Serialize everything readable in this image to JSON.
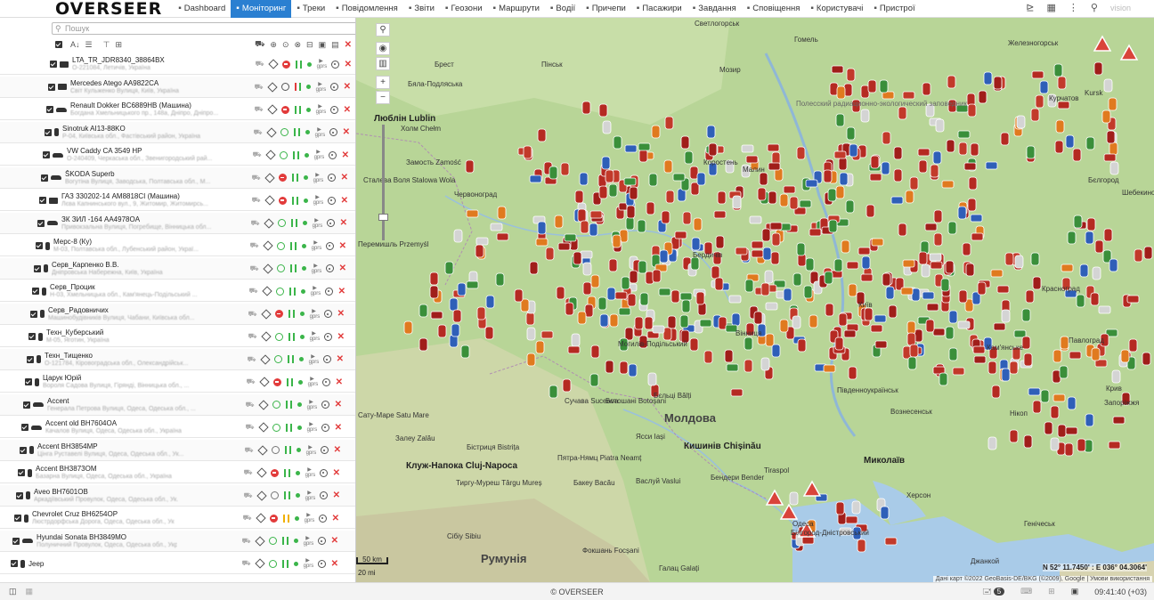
{
  "app": {
    "logo_text": "OVERSEER",
    "nav": [
      {
        "label": "Dashboard",
        "icon": "bar-chart-icon",
        "active": false
      },
      {
        "label": "Моніторинг",
        "icon": "globe-icon",
        "active": true
      },
      {
        "label": "Треки",
        "icon": "track-icon",
        "active": false
      },
      {
        "label": "Повідомлення",
        "icon": "message-icon",
        "active": false
      },
      {
        "label": "Звіти",
        "icon": "report-icon",
        "active": false
      },
      {
        "label": "Геозони",
        "icon": "geozone-icon",
        "active": false
      },
      {
        "label": "Маршрути",
        "icon": "route-icon",
        "active": false
      },
      {
        "label": "Водії",
        "icon": "driver-icon",
        "active": false
      },
      {
        "label": "Причепи",
        "icon": "trailer-icon",
        "active": false
      },
      {
        "label": "Пасажири",
        "icon": "passenger-icon",
        "active": false
      },
      {
        "label": "Завдання",
        "icon": "task-icon",
        "active": false
      },
      {
        "label": "Сповіщення",
        "icon": "bell-icon",
        "active": false
      },
      {
        "label": "Користувачі",
        "icon": "users-icon",
        "active": false
      },
      {
        "label": "Пристрої",
        "icon": "device-icon",
        "active": false
      }
    ],
    "user_label": "vision"
  },
  "sidebar": {
    "search_placeholder": "Пошук",
    "units": [
      {
        "name": "LTA_TR_JDR8340_38864BX",
        "address": "О-221084, Летичів, Україна",
        "icon": "truck",
        "state": "red"
      },
      {
        "name": "Mercedes Atego AA9822CA",
        "address": "Світ Кульженко Вулиця, Київ, Україна",
        "icon": "truck",
        "state": "split"
      },
      {
        "name": "Renault Dokker BC6889HB (Машина)",
        "address": "Богдана Хмельницького пр., 148а, Дніпро, Дніпро...",
        "icon": "car",
        "state": "red"
      },
      {
        "name": "Sinotruk AI13-88KO",
        "address": "Р-04, Київська обл., Фастівський район, Україна",
        "icon": "person",
        "state": "green"
      },
      {
        "name": "VW Caddy CA 3549 HP",
        "address": "О-240409, Черкаська обл., Звенигородський рай...",
        "icon": "car",
        "state": "green"
      },
      {
        "name": "ŠKODA Superb",
        "address": "Вогутіна Вулиця, Заводська, Полтавська обл., М...",
        "icon": "car",
        "state": "red"
      },
      {
        "name": "ГАЗ 330202-14 AM8818CI (Машина)",
        "address": "Лєва Капнинського вул., 9, Житомир, Житомирсь...",
        "icon": "truck",
        "state": "red"
      },
      {
        "name": "ЗК ЗИЛ -164 AA4978OA",
        "address": "Привокзальна Вулиця, Погребище, Вінницька обл...",
        "icon": "car",
        "state": "green"
      },
      {
        "name": "Мерс-8 (Ку)",
        "address": "М-03, Полтавська обл., Лубенський район, Украї...",
        "icon": "person",
        "state": "green"
      },
      {
        "name": "Серв_Карпенко В.В.",
        "address": "Дніпровська Набережна, Київ, Україна",
        "icon": "person",
        "state": "green"
      },
      {
        "name": "Серв_Процик",
        "address": "Н-03, Хмельницька обл., Кам'янець-Подільський ...",
        "icon": "person",
        "state": "green"
      },
      {
        "name": "Серв_Радовничих",
        "address": "Машинобудівників Вулиця, Чабани, Київська обл...",
        "icon": "person",
        "state": "red"
      },
      {
        "name": "Техн_Куберський",
        "address": "М-05, Яготин, Україна",
        "icon": "person",
        "state": "green"
      },
      {
        "name": "Техн_Тищенко",
        "address": "О-121784, Кіровоградська обл., Олександрійськ...",
        "icon": "person",
        "state": "green"
      },
      {
        "name": "Царук Юрій",
        "address": "Вороля Садова Вулиця, Гірянді, Вінницька обл., ...",
        "icon": "person",
        "state": "red"
      },
      {
        "name": "Accent",
        "address": "Генерала Петрова Вулиця, Одеса, Одеська обл., ...",
        "icon": "car",
        "state": "green"
      },
      {
        "name": "Accent old BH7604OA",
        "address": "Качалов Вулиця, Одеса, Одеська обл., Україна",
        "icon": "car",
        "state": "green"
      },
      {
        "name": "Accent BH3854MP",
        "address": "Цінга Руставелі Вулиця, Одеса, Одеська обл., Ук...",
        "icon": "person",
        "state": "gray"
      },
      {
        "name": "Accent BH3873OM",
        "address": "Базарна Вулиця, Одеса, Одеська обл., Україна",
        "icon": "person",
        "state": "red"
      },
      {
        "name": "Aveo BH7601OB",
        "address": "Аркадіївський Провулок, Одеса, Одеська обл., Ук...",
        "icon": "person",
        "state": "gray"
      },
      {
        "name": "Chevrolet Cruz BH6254OP",
        "address": "Люстрдорфська Дорога, Одеса, Одеська обл., Укр...",
        "icon": "person",
        "state": "red"
      },
      {
        "name": "Hyundai Sonata BH3849MO",
        "address": "Полуничний Провулок, Одеса, Одеська обл., Укр...",
        "icon": "car",
        "state": "green"
      },
      {
        "name": "Jeep",
        "address": "",
        "icon": "person",
        "state": "green"
      }
    ]
  },
  "map": {
    "labels": [
      {
        "text": "Светлогорськ",
        "cls": ""
      },
      {
        "text": "Гомель",
        "cls": ""
      },
      {
        "text": "Железногорськ",
        "cls": ""
      },
      {
        "text": "Пінськ",
        "cls": ""
      },
      {
        "text": "Брест",
        "cls": ""
      },
      {
        "text": "Мозир",
        "cls": ""
      },
      {
        "text": "Курчатов",
        "cls": ""
      },
      {
        "text": "Kursk",
        "cls": ""
      },
      {
        "text": "Бяла-Подляська",
        "cls": ""
      },
      {
        "text": "Люблін Lublin",
        "cls": "mid"
      },
      {
        "text": "Холм Chełm",
        "cls": ""
      },
      {
        "text": "Полесский радиационно-экологический заповедник",
        "cls": "region"
      },
      {
        "text": "Замость Zamość",
        "cls": ""
      },
      {
        "text": "Сталева Воля Stalowa Wola",
        "cls": ""
      },
      {
        "text": "Коростень",
        "cls": ""
      },
      {
        "text": "Малин",
        "cls": ""
      },
      {
        "text": "Бєлгород",
        "cls": ""
      },
      {
        "text": "Червоноград",
        "cls": ""
      },
      {
        "text": "Шебекино",
        "cls": ""
      },
      {
        "text": "Перемишль Przemyśl",
        "cls": ""
      },
      {
        "text": "Бердичів",
        "cls": ""
      },
      {
        "text": "Красноград",
        "cls": ""
      },
      {
        "text": "Павлоград",
        "cls": ""
      },
      {
        "text": "Кам'янське",
        "cls": ""
      },
      {
        "text": "Крив",
        "cls": ""
      },
      {
        "text": "Сату-Маре Satu Mare",
        "cls": ""
      },
      {
        "text": "Сучава Suceava",
        "cls": ""
      },
      {
        "text": "Ботошані Botoșani",
        "cls": ""
      },
      {
        "text": "Бєльці Bălți",
        "cls": ""
      },
      {
        "text": "Молдова",
        "cls": "big"
      },
      {
        "text": "Залеу Zalău",
        "cls": ""
      },
      {
        "text": "Ясси Iași",
        "cls": ""
      },
      {
        "text": "Кишинів Chișinău",
        "cls": "mid"
      },
      {
        "text": "Бістриця Bistrița",
        "cls": ""
      },
      {
        "text": "Пятра-Нямц Piatra Neamț",
        "cls": ""
      },
      {
        "text": "Клуж-Напока Cluj-Napoca",
        "cls": "mid"
      },
      {
        "text": "Тиргу-Муреш Târgu Mureș",
        "cls": ""
      },
      {
        "text": "Бакеу Bacău",
        "cls": ""
      },
      {
        "text": "Васлуй Vaslui",
        "cls": ""
      },
      {
        "text": "Бендери Bender",
        "cls": ""
      },
      {
        "text": "Tiraspol",
        "cls": ""
      },
      {
        "text": "Миколаїв",
        "cls": "mid"
      },
      {
        "text": "Херсон",
        "cls": ""
      },
      {
        "text": "Сібіу Sibiu",
        "cls": ""
      },
      {
        "text": "Румунія",
        "cls": "big"
      },
      {
        "text": "Фокшань Focșani",
        "cls": ""
      },
      {
        "text": "Галац Galați",
        "cls": ""
      },
      {
        "text": "Одеса",
        "cls": ""
      },
      {
        "text": "Генічеськ",
        "cls": ""
      },
      {
        "text": "Джанкой",
        "cls": ""
      },
      {
        "text": "Білгород-Дністровський",
        "cls": ""
      },
      {
        "text": "Нікоп",
        "cls": ""
      },
      {
        "text": "Запоріжжя",
        "cls": ""
      },
      {
        "text": "Південноукраїнськ",
        "cls": ""
      },
      {
        "text": "Вознесенськ",
        "cls": ""
      },
      {
        "text": "Могилів-Подільський",
        "cls": ""
      },
      {
        "text": "Вінниця",
        "cls": ""
      },
      {
        "text": "Київ",
        "cls": ""
      }
    ],
    "coords": "N 52° 11.7450' : E 036° 04.3064'",
    "attribution": "Дані карт ©2022 GeoBasis-DE/BKG (©2009), Google | Умови використання",
    "scale_top": "50 km",
    "scale_bottom": "20 mi",
    "google": "Google"
  },
  "footer": {
    "copyright": "© OVERSEER",
    "badge": "5",
    "time": "09:41:40 (+03)"
  }
}
